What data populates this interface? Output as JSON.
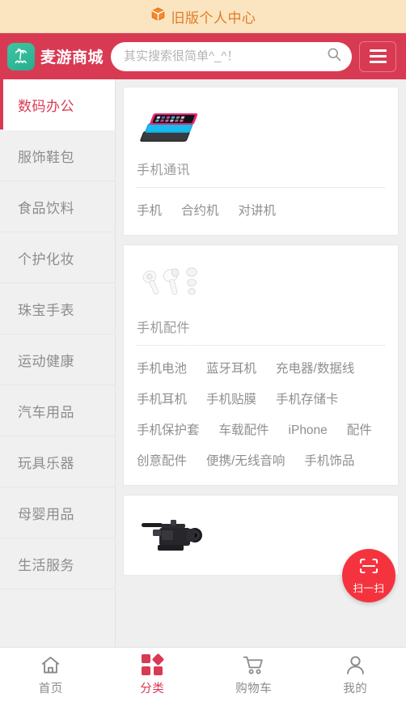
{
  "banner": {
    "icon": "box-icon",
    "label": "旧版个人中心"
  },
  "header": {
    "brand_name": "麦游商城",
    "logo_icon": "palm-tree-logo-icon",
    "search_placeholder": "其实搜索很简单^_^！",
    "search_value": "",
    "search_icon": "search-icon",
    "menu_icon": "hamburger-menu-icon",
    "bg_color": "#d93a53"
  },
  "sidebar": {
    "active_index": 0,
    "items": [
      {
        "label": "数码办公"
      },
      {
        "label": "服饰鞋包"
      },
      {
        "label": "食品饮料"
      },
      {
        "label": "个护化妆"
      },
      {
        "label": "珠宝手表"
      },
      {
        "label": "运动健康"
      },
      {
        "label": "汽车用品"
      },
      {
        "label": "玩具乐器"
      },
      {
        "label": "母婴用品"
      },
      {
        "label": "生活服务"
      }
    ]
  },
  "content": {
    "cards": [
      {
        "thumb": "stacked-phones-image",
        "title": "手机通讯",
        "links": [
          "手机",
          "合约机",
          "对讲机"
        ]
      },
      {
        "thumb": "earbuds-image",
        "title": "手机配件",
        "links": [
          "手机电池",
          "蓝牙耳机",
          "充电器/数据线",
          "手机耳机",
          "手机贴膜",
          "手机存储卡",
          "手机保护套",
          "车载配件",
          "iPhone",
          "配件",
          "创意配件",
          "便携/无线音响",
          "手机饰品"
        ]
      },
      {
        "thumb": "camcorder-image",
        "title": "",
        "links": []
      }
    ]
  },
  "scan_button": {
    "icon": "scan-frame-icon",
    "label": "扫一扫",
    "color": "#f5333f"
  },
  "tabbar": {
    "active_index": 1,
    "items": [
      {
        "label": "首页",
        "icon": "home-icon"
      },
      {
        "label": "分类",
        "icon": "grid-categories-icon"
      },
      {
        "label": "购物车",
        "icon": "shopping-cart-icon"
      },
      {
        "label": "我的",
        "icon": "user-profile-icon"
      }
    ]
  },
  "colors": {
    "brand_red": "#d93a53",
    "accent_red": "#f5333f",
    "banner_bg": "#fbe5c1",
    "banner_text": "#e07b26",
    "logo_green": "#2fb898"
  }
}
